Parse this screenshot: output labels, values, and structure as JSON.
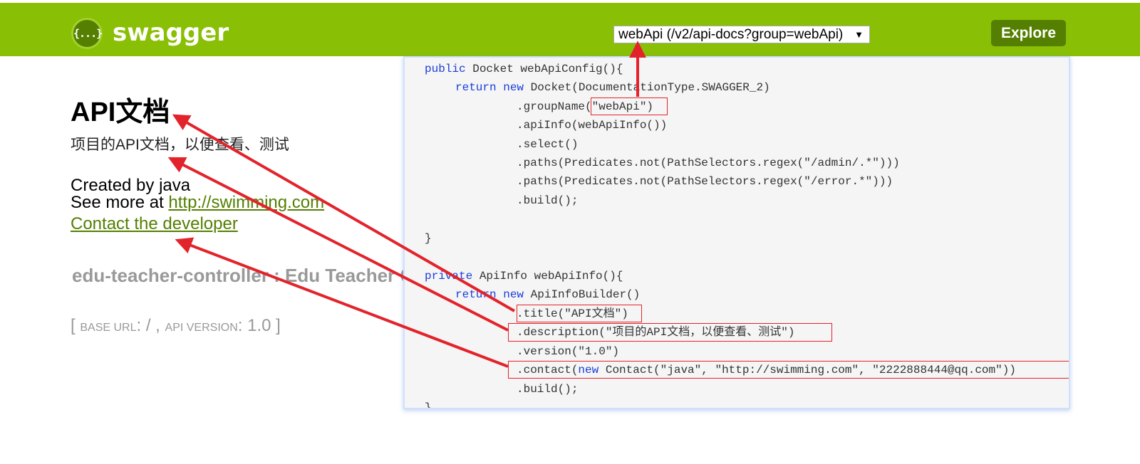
{
  "header": {
    "logo_icon": "{...}",
    "logo_text": "swagger",
    "api_selector": "webApi (/v2/api-docs?group=webApi)",
    "explore_label": "Explore"
  },
  "info": {
    "title": "API文档",
    "description": "项目的API文档，以便查看、测试",
    "created_by": "Created by java",
    "see_more_prefix": "See more at ",
    "see_more_link": "http://swimming.com",
    "contact_link": "Contact the developer"
  },
  "resource": {
    "title": "edu-teacher-controller : Edu Teacher Controller",
    "base_url_label": "BASE URL",
    "base_url_value": "/",
    "api_version_label": "API VERSION",
    "api_version_value": "1.0"
  },
  "code": {
    "l1_kw": "public",
    "l1_rest": " Docket webApiConfig(){",
    "l2_kw1": "return",
    "l2_kw2": "new",
    "l2_rest": " Docket(DocumentationType.SWAGGER_2)",
    "l3_pre": ".groupName",
    "l3_hl": "(\"webApi\")",
    "l4": ".apiInfo(webApiInfo())",
    "l5": ".select()",
    "l6": ".paths(Predicates.not(PathSelectors.regex(\"/admin/.*\")))",
    "l7": ".paths(Predicates.not(PathSelectors.regex(\"/error.*\")))",
    "l8": ".build();",
    "l9": "}",
    "l10_kw": "private",
    "l10_rest": " ApiInfo webApiInfo(){",
    "l11_kw1": "return",
    "l11_kw2": "new",
    "l11_rest": " ApiInfoBuilder()",
    "l12": ".title(\"API文档\")",
    "l13": ".description(\"项目的API文档，以便查看、测试\")",
    "l14": ".version(\"1.0\")",
    "l15_pre": ".contact(",
    "l15_kw": "new",
    "l15_rest": " Contact(\"java\", \"http://swimming.com\", \"2222888444@qq.com\"))",
    "l16": ".build();",
    "l17": "}"
  },
  "colors": {
    "header_bg": "#89bf04",
    "explore_bg": "#547f00",
    "link": "#547f00",
    "keyword": "#1a3ddb",
    "annotation_red": "#e3232b"
  }
}
